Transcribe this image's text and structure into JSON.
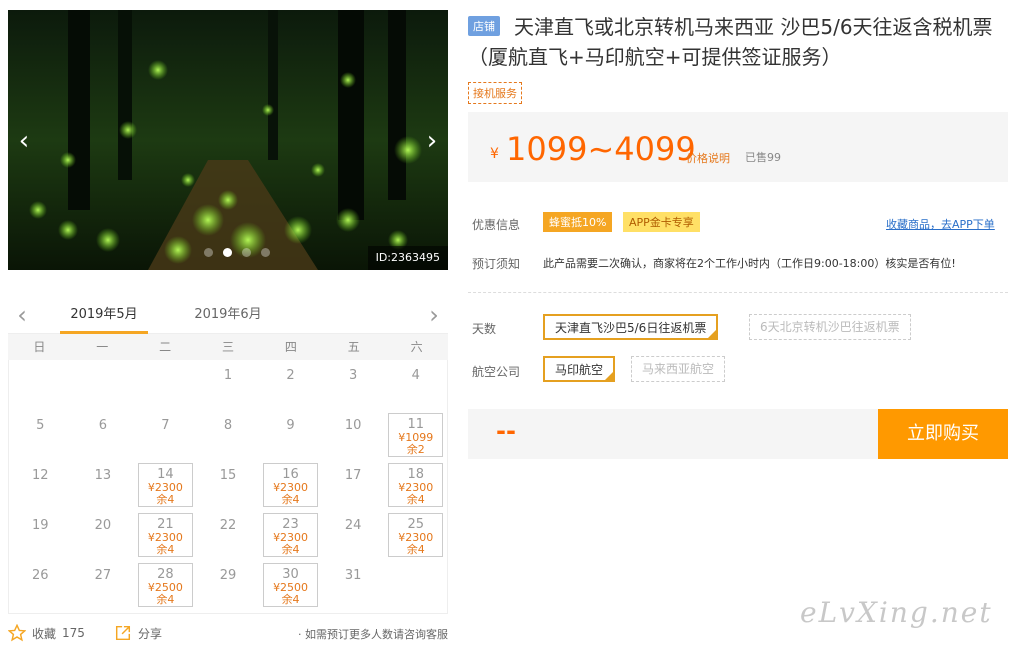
{
  "gallery": {
    "id_label": "ID:2363495",
    "dot_count": 4,
    "active_dot": 1
  },
  "calendar": {
    "months": [
      "2019年5月",
      "2019年6月"
    ],
    "weekdays": [
      "日",
      "一",
      "二",
      "三",
      "四",
      "五",
      "六"
    ],
    "days": [
      {
        "d": ""
      },
      {
        "d": ""
      },
      {
        "d": ""
      },
      {
        "d": "1"
      },
      {
        "d": "2"
      },
      {
        "d": "3"
      },
      {
        "d": "4"
      },
      {
        "d": "5"
      },
      {
        "d": "6"
      },
      {
        "d": "7"
      },
      {
        "d": "8"
      },
      {
        "d": "9"
      },
      {
        "d": "10"
      },
      {
        "d": "11",
        "price": "¥1099",
        "remain": "余2"
      },
      {
        "d": "12"
      },
      {
        "d": "13"
      },
      {
        "d": "14",
        "price": "¥2300",
        "remain": "余4"
      },
      {
        "d": "15"
      },
      {
        "d": "16",
        "price": "¥2300",
        "remain": "余4"
      },
      {
        "d": "17"
      },
      {
        "d": "18",
        "price": "¥2300",
        "remain": "余4"
      },
      {
        "d": "19"
      },
      {
        "d": "20"
      },
      {
        "d": "21",
        "price": "¥2300",
        "remain": "余4"
      },
      {
        "d": "22"
      },
      {
        "d": "23",
        "price": "¥2300",
        "remain": "余4"
      },
      {
        "d": "24"
      },
      {
        "d": "25",
        "price": "¥2300",
        "remain": "余4"
      },
      {
        "d": "26"
      },
      {
        "d": "27"
      },
      {
        "d": "28",
        "price": "¥2500",
        "remain": "余4"
      },
      {
        "d": "29"
      },
      {
        "d": "30",
        "price": "¥2500",
        "remain": "余4"
      },
      {
        "d": "31"
      },
      {
        "d": ""
      }
    ]
  },
  "footer": {
    "fav_label": "收藏",
    "fav_count": "175",
    "share_label": "分享",
    "consult": "· 如需预订更多人数请咨询客服"
  },
  "product": {
    "shop_tag": "店铺",
    "title": "天津直飞或北京转机马来西亚 沙巴5/6天往返含税机票（厦航直飞+马印航空+可提供签证服务）",
    "service_tag": "接机服务",
    "currency": "¥",
    "price": "1099~4099",
    "price_note": "价格说明",
    "sold": "已售99"
  },
  "promo": {
    "label": "优惠信息",
    "badges": [
      "蜂蜜抵10%",
      "APP金卡专享"
    ],
    "app_link": "收藏商品，去APP下单"
  },
  "notice": {
    "label": "预订须知",
    "text": "此产品需要二次确认，商家将在2个工作小时内（工作日9:00-18:00）核实是否有位!"
  },
  "options": {
    "days_label": "天数",
    "days": [
      {
        "label": "天津直飞沙巴5/6日往返机票",
        "state": "selected"
      },
      {
        "label": "6天北京转机沙巴往返机票",
        "state": "disabled"
      }
    ],
    "airline_label": "航空公司",
    "airlines": [
      {
        "label": "马印航空",
        "state": "selected"
      },
      {
        "label": "马来西亚航空",
        "state": "disabled"
      }
    ]
  },
  "buy": {
    "total": "--",
    "button": "立即购买"
  },
  "watermark": "eLvXing.net"
}
